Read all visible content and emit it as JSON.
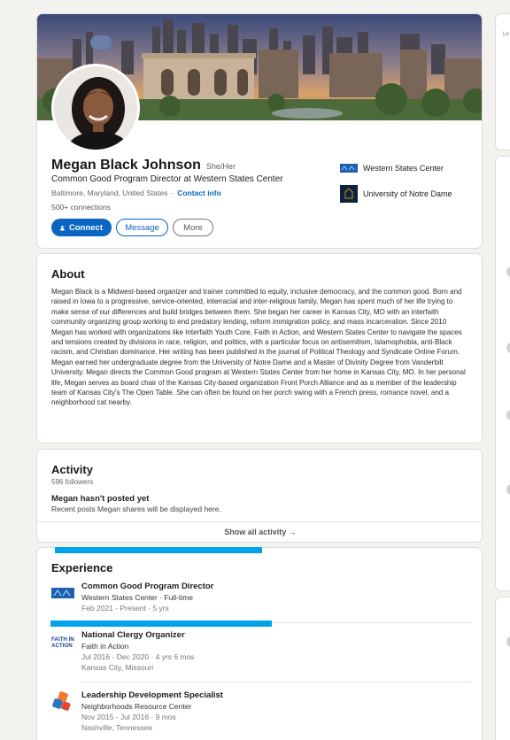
{
  "profile": {
    "name": "Megan Black Johnson",
    "pronouns": "She/Her",
    "headline": "Common Good Program Director at Western States Center",
    "location": "Baltimore, Maryland, United States",
    "location_separator": "·",
    "contact_info": "Contact info",
    "connections": "500+ connections",
    "actions": {
      "connect": "Connect",
      "message": "Message",
      "more": "More"
    },
    "organizations": [
      {
        "name": "Western States Center",
        "logo_icon": "western-states-center-logo"
      },
      {
        "name": "University of Notre Dame",
        "logo_icon": "notre-dame-logo"
      }
    ]
  },
  "about": {
    "title": "About",
    "text": "Megan Black is a Midwest-based organizer and trainer committed to equity, inclusive democracy, and the common good. Born and raised in Iowa to a progressive, service-oriented, interracial and inter-religious family, Megan has spent much of her life trying to make sense of our differences and build bridges between them. She began her career in Kansas City, MO with an interfaith community organizing group working to end predatory lending, reform immigration policy, and mass incarceration. Since 2010 Megan has worked with organizations like Interfaith Youth Core, Faith in Action, and Western States Center to navigate the spaces and tensions created by divisions in race, religion, and politics, with a particular focus on antisemitism, Islamophobia, anti-Black racism, and Christian dominance. Her writing has been published in the journal of Political Theology and Syndicate Online Forum. Megan earned her undergraduate degree from the University of Notre Dame and a Master of Divinity Degree from Vanderbilt University. Megan directs the Common Good program at Western States Center from her home in Kansas City, MO. In her personal life, Megan serves as board chair of the Kansas City-based organization Front Porch Alliance and as a member of the leadership team of Kansas City's The Open Table. She can often be found on her porch swing with a French press, romance novel, and a neighborhood cat nearby."
  },
  "activity": {
    "title": "Activity",
    "followers": "596 followers",
    "empty_title": "Megan hasn't posted yet",
    "empty_subtitle": "Recent posts Megan shares will be displayed here.",
    "show_all": "Show all activity →"
  },
  "experience": {
    "title": "Experience",
    "items": [
      {
        "title": "Common Good Program Director",
        "org": "Western States Center · Full-time",
        "dates": "Feb 2021 - Present · 5 yrs",
        "location": "",
        "logo_icon": "western-states-center-logo"
      },
      {
        "title": "National Clergy Organizer",
        "org": "Faith in Action",
        "dates": "Jul 2016 - Dec 2020 · 4 yrs 6 mos",
        "location": "Kansas City, Missouri",
        "logo_icon": "faith-in-action-logo"
      },
      {
        "title": "Leadership Development Specialist",
        "org": "Neighborhoods Resource Center",
        "dates": "Nov 2015 - Jul 2016 · 9 mos",
        "location": "Nashville, Tennessee",
        "logo_icon": "neighborhoods-resource-center-logo"
      }
    ]
  },
  "logo_text": {
    "faith_in_action": "FAITH IN ACTION"
  },
  "right_column": {
    "fragment_top": "Le"
  },
  "colors": {
    "accent": "#0a66c2",
    "highlight_bar": "#00a3e8",
    "page_background": "#f3f2ef"
  }
}
